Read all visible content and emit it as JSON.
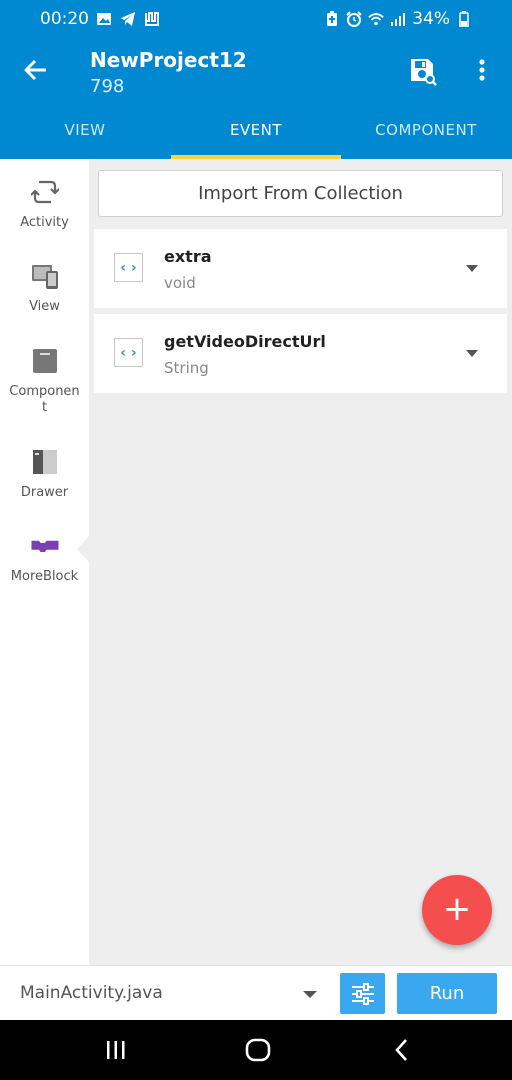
{
  "status_bar": {
    "time": "00:20",
    "battery": "34%",
    "left_icons": [
      "image-icon",
      "telegram-icon",
      "mi-icon"
    ],
    "right_icons": [
      "battery-saver-icon",
      "alarm-icon",
      "wifi-icon",
      "signal-icon",
      "battery-icon"
    ]
  },
  "app_bar": {
    "project_name": "NewProject12",
    "project_id": "798",
    "back_icon": "arrow-back-icon",
    "save_icon": "save-icon",
    "menu_icon": "more-vertical-icon"
  },
  "tabs": [
    {
      "label": "VIEW",
      "active": false
    },
    {
      "label": "EVENT",
      "active": true
    },
    {
      "label": "COMPONENT",
      "active": false
    }
  ],
  "colors": {
    "primary": "#0088d1",
    "tab_indicator": "#f7d33c",
    "fab": "#f44e4e",
    "button": "#39a8f0",
    "moreblock": "#7b3fb5"
  },
  "sidebar": {
    "items": [
      {
        "label": "Activity",
        "icon": "activity-cycle-icon"
      },
      {
        "label": "View",
        "icon": "view-devices-icon"
      },
      {
        "label": "Componen\nt",
        "icon": "component-box-icon"
      },
      {
        "label": "Drawer",
        "icon": "drawer-icon"
      },
      {
        "label": "MoreBlock",
        "icon": "moreblock-icon",
        "selected": true
      }
    ]
  },
  "main": {
    "import_label": "Import From Collection",
    "events": [
      {
        "name": "extra",
        "type": "void",
        "icon": "code-brackets-icon"
      },
      {
        "name": "getVideoDirectUrl",
        "type": "String",
        "icon": "code-brackets-icon"
      }
    ],
    "fab_icon": "plus-icon",
    "fab_label": "+"
  },
  "bottom_bar": {
    "file": "MainActivity.java",
    "run_label": "Run",
    "settings_icon": "sliders-icon"
  },
  "nav_bar": {
    "icons": [
      "recent-apps-icon",
      "home-icon",
      "back-icon"
    ]
  }
}
